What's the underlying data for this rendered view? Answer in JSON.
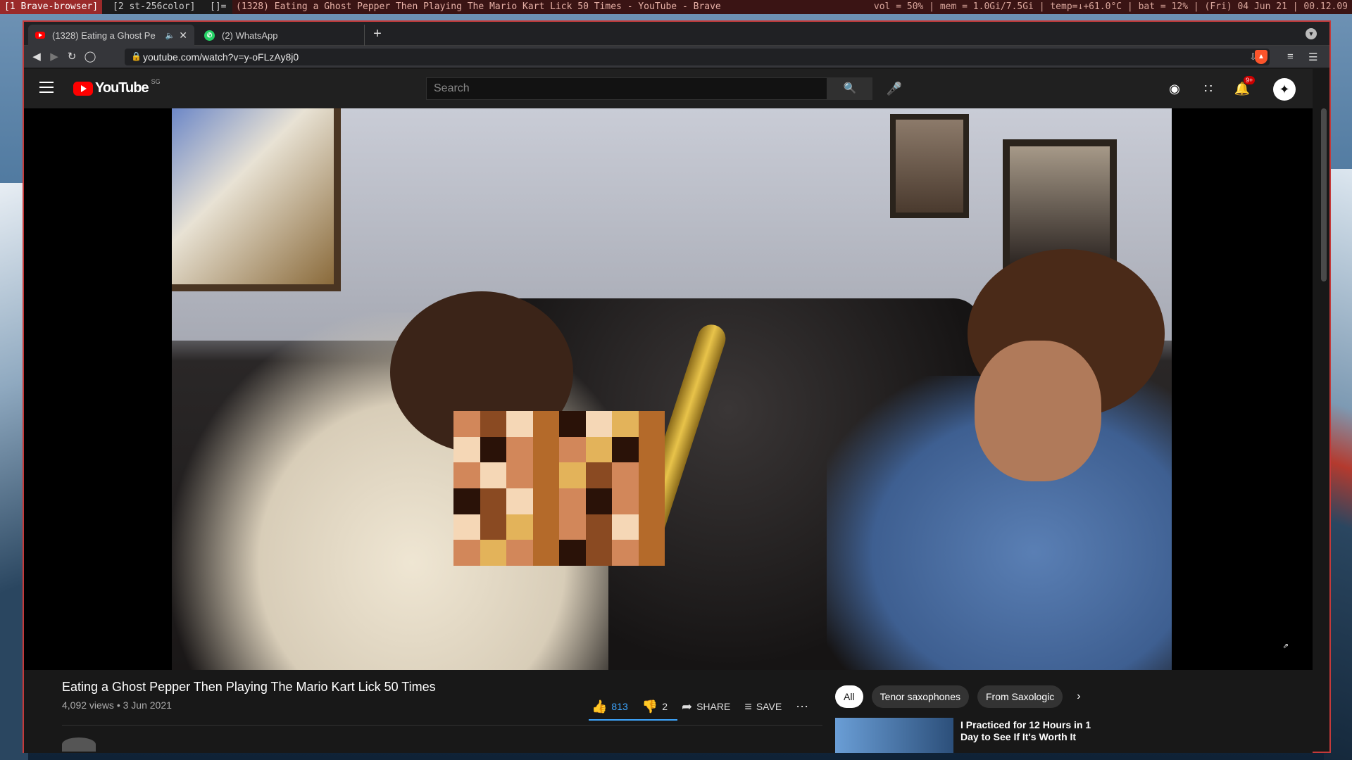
{
  "statusbar": {
    "workspace_1": "[1 Brave-browser]",
    "workspace_2": "[2 st-256color]",
    "layout": "[]=",
    "window_title": "(1328) Eating a Ghost Pepper Then Playing The Mario Kart Lick 50 Times - YouTube - Brave",
    "system_info": "vol = 50% | mem = 1.0Gi/7.5Gi | temp=↓+61.0°C | bat = 12% | (Fri) 04 Jun 21 | 00.12.09"
  },
  "browser": {
    "tabs": [
      {
        "label": "(1328) Eating a Ghost Pe",
        "favicon": "youtube-icon",
        "muted": true
      },
      {
        "label": "(2) WhatsApp",
        "favicon": "whatsapp-icon"
      }
    ],
    "new_tab": "+",
    "url": "youtube.com/watch?v=y-oFLzAy8j0"
  },
  "youtube": {
    "logo_text": "YouTube",
    "region": "SG",
    "search_placeholder": "Search",
    "notification_badge": "9+",
    "video": {
      "title": "Eating a Ghost Pepper Then Playing The Mario Kart Lick 50 Times",
      "meta": "4,092 views • 3 Jun 2021",
      "likes": "813",
      "dislikes": "2",
      "share_label": "SHARE",
      "save_label": "SAVE"
    },
    "chips": [
      "All",
      "Tenor saxophones",
      "From Saxologic"
    ],
    "recommendations": [
      {
        "title": "I Practiced for 12 Hours in 1 Day to See If It's Worth It"
      }
    ]
  },
  "colors": {
    "accent_blue": "#3ea6ff",
    "youtube_red": "#ff0000",
    "window_border": "#c43a3a"
  }
}
